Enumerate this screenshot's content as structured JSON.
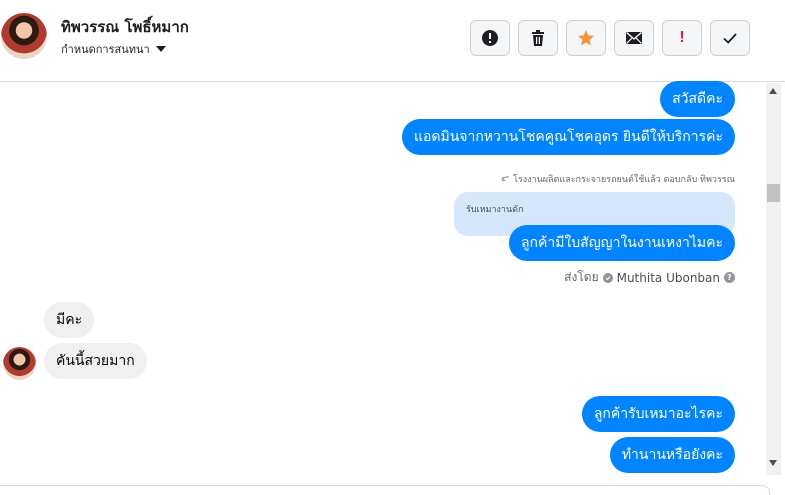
{
  "contact": {
    "name": "ทิพวรรณ โพธิ์หมาก",
    "subtitle": "กำหนดการสนทนา"
  },
  "toolbar": {
    "buttons": [
      {
        "icon": "alert-circle-icon"
      },
      {
        "icon": "trash-icon"
      },
      {
        "icon": "star-icon",
        "color": "#f7923a"
      },
      {
        "icon": "envelope-icon"
      },
      {
        "icon": "exclamation-icon",
        "label": "!",
        "color": "#e41e3f"
      },
      {
        "icon": "checkmark-icon"
      }
    ]
  },
  "messages": {
    "out_1": "สวัสดีคะ",
    "out_2": "แอดมินจากหวานโชคคูณโชคอุดร ยินดีให้บริการค่ะ",
    "reply_context": "โรงงานผลิตและกระจายรถยนต์ใช้แล้ว ตอบกลับ ทิพวรรณ",
    "quoted": "รับเหมางานดัก",
    "out_3": "ลูกค้ามีใบสัญญาในงานเหงาไมคะ",
    "sent_by_prefix": "ส่งโดย",
    "sent_by_agent": "Muthita Ubonban",
    "in_1": "มีคะ",
    "in_2": "คันนี้สวยมาก",
    "out_4": "ลูกค้ารับเหมาอะไรคะ",
    "out_5": "ทำนานหรือยังคะ"
  },
  "colors": {
    "outgoing_bubble": "#0084ff",
    "incoming_bubble": "#f0f0f0",
    "quoted_bubble": "#d6e6fb"
  }
}
